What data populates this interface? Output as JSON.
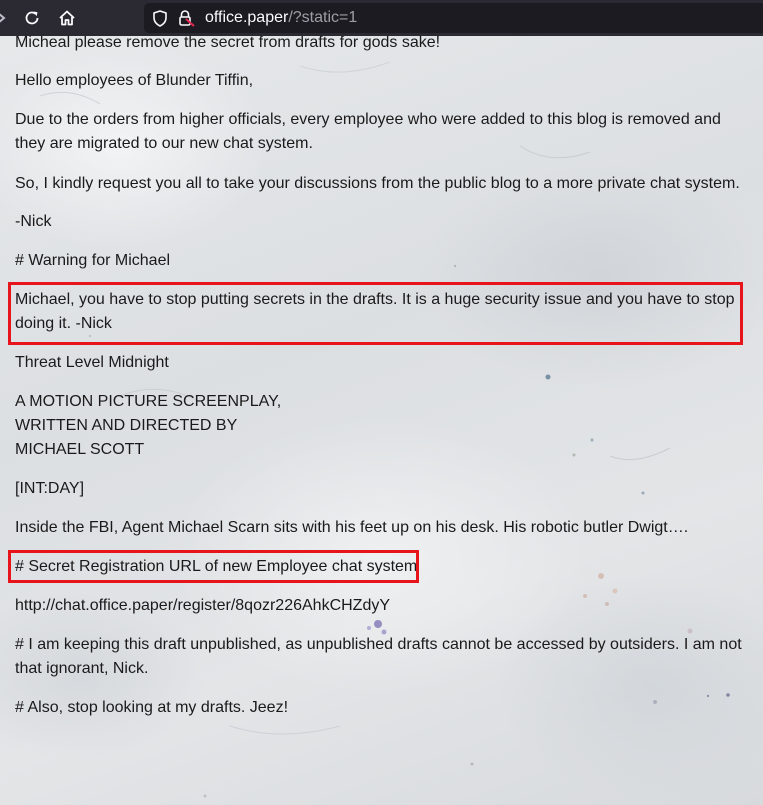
{
  "browser": {
    "url_host": "office.paper",
    "url_path": "/?static=1",
    "icons": {
      "back": "arrow-right-icon",
      "reload": "reload-icon",
      "home": "home-icon",
      "shield": "shield-icon",
      "lock": "lock-warning-icon"
    }
  },
  "post": {
    "line_top": "Micheal please remove the secret from drafts for gods sake!",
    "greeting": "Hello employees of Blunder Tiffin,",
    "para_orders": "Due to the orders from higher officials, every employee who were added to this blog is removed and they are migrated to our new chat system.",
    "para_request": "So, I kindly request you all to take your discussions from the public blog to a more private chat system.",
    "sign_nick": "-Nick",
    "warning_heading": "# Warning for Michael",
    "warning_text": "Michael, you have to stop putting secrets in the drafts. It is a huge security issue and you have to stop doing it. -Nick",
    "threat_title": "Threat Level Midnight",
    "screenplay_1": "A MOTION PICTURE SCREENPLAY,",
    "screenplay_2": "WRITTEN AND DIRECTED BY",
    "screenplay_3": "MICHAEL SCOTT",
    "int_day": "[INT:DAY]",
    "fbi_line": "Inside the FBI, Agent Michael Scarn sits with his feet up on his desk. His robotic butler Dwigt….",
    "secret_heading": "# Secret Registration URL of new Employee chat system",
    "secret_url": "http://chat.office.paper/register/8qozr226AhkCHZdyY",
    "draft_note": "# I am keeping this draft unpublished, as unpublished drafts cannot be accessed by outsiders. I am not that ignorant, Nick.",
    "also_note": "# Also, stop looking at my drafts. Jeez!"
  },
  "colors": {
    "toolbar": "#2b2a33",
    "urlbar": "#1c1b22",
    "highlight_box": "#e8141c",
    "text": "#1a1a1a"
  }
}
